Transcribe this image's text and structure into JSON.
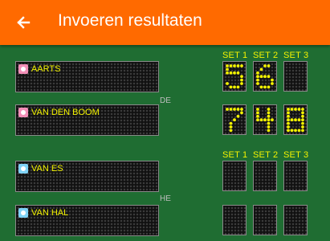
{
  "header": {
    "title": "Invoeren resultaten",
    "back_icon": "arrow-left-icon"
  },
  "colors": {
    "app_bar": "#ff6a00",
    "background": "#1f6d32",
    "led_on": "#f3f300",
    "led_off": "#3b3b3b"
  },
  "matches": [
    {
      "type": "DE",
      "set_headers": [
        "SET 1",
        "SET 2",
        "SET 3"
      ],
      "players": [
        {
          "name": "AARTS",
          "icon": "female-icon"
        },
        {
          "name": "VAN DEN BOOM",
          "icon": "female-icon"
        }
      ],
      "scores": [
        [
          "5",
          "6",
          ""
        ],
        [
          "7",
          "4",
          "8"
        ]
      ]
    },
    {
      "type": "HE",
      "set_headers": [
        "SET 1",
        "SET 2",
        "SET 3"
      ],
      "players": [
        {
          "name": "VAN ES",
          "icon": "male-icon"
        },
        {
          "name": "VAN HAL",
          "icon": "male-icon"
        }
      ],
      "scores": [
        [
          "",
          "",
          ""
        ],
        [
          "",
          "",
          ""
        ]
      ]
    }
  ]
}
